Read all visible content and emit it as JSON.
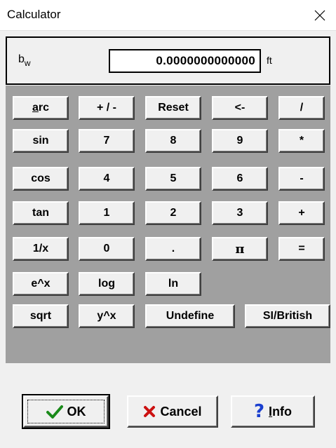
{
  "window": {
    "title": "Calculator",
    "close_icon": "close-icon"
  },
  "display": {
    "variable": "b",
    "variable_subscript": "w",
    "value": "0.0000000000000",
    "unit": "ft"
  },
  "keys": {
    "arc": {
      "underlined": "a",
      "rest": "rc"
    },
    "plus_minus": "+ / -",
    "reset": "Reset",
    "backspace": "<-",
    "divide": "/",
    "sin": "sin",
    "n7": "7",
    "n8": "8",
    "n9": "9",
    "multiply": "*",
    "cos": "cos",
    "n4": "4",
    "n5": "5",
    "n6": "6",
    "minus": "-",
    "tan": "tan",
    "n1": "1",
    "n2": "2",
    "n3": "3",
    "plus": "+",
    "reciprocal": "1/x",
    "n0": "0",
    "decimal": ".",
    "pi": "π",
    "equals": "=",
    "exp": "e^x",
    "log": "log",
    "ln": "ln",
    "sqrt": "sqrt",
    "power": "y^x",
    "undefine": "Undefine",
    "si_british": "SI/British"
  },
  "dialog_buttons": {
    "ok": "OK",
    "cancel": "Cancel",
    "info": {
      "underlined": "I",
      "rest": "nfo"
    }
  },
  "colors": {
    "ok_check": "#1a8a1a",
    "cancel_x": "#cc1111",
    "info_q": "#1a3fcf",
    "keypad_bg": "#a0a0a0"
  }
}
